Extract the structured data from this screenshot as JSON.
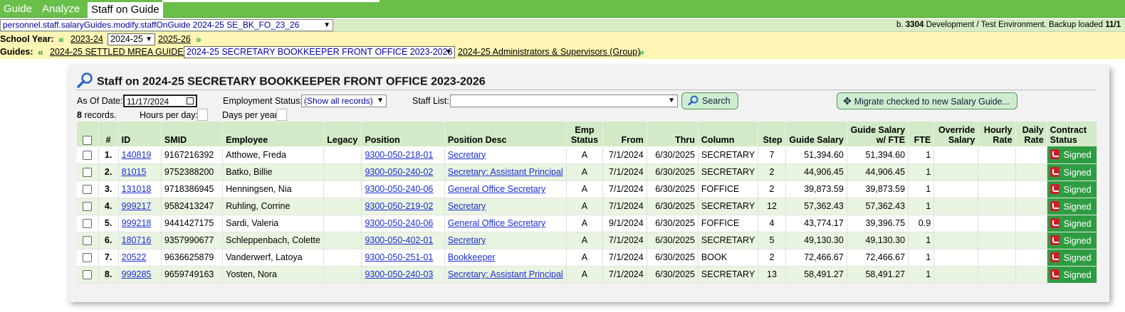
{
  "nav": {
    "tabs": [
      {
        "label": "Guide"
      },
      {
        "label": "Analyze"
      },
      {
        "label": "Staff on Guide"
      }
    ]
  },
  "pathbar": {
    "path": "personnel.staff.salaryGuides.modify.staffOnGuide 2024-25 SE_BK_FO_23_26",
    "build_prefix": "b.",
    "build_number": "3304",
    "env_text": "Development / Test Environment. Backup loaded",
    "env_date": "11/1"
  },
  "school_year": {
    "label": "School Year:",
    "prev": "2023-24",
    "current": "2024-25",
    "next": "2025-26"
  },
  "guides": {
    "label": "Guides:",
    "prev": "2024-25 SETTLED MREA GUIDES",
    "current": "2024-25 SECRETARY BOOKKEEPER FRONT OFFICE 2023-2026",
    "next": "2024-25 Administrators & Supervisors (Group)"
  },
  "panel": {
    "title": "Staff on 2024-25 SECRETARY BOOKKEEPER FRONT OFFICE 2023-2026",
    "as_of_label": "As Of Date:",
    "as_of_value": "11/17/2024",
    "emp_status_label": "Employment Status:",
    "emp_status_value": "(Show all records)",
    "staff_list_label": "Staff List:",
    "staff_list_value": "",
    "search_label": "Search",
    "migrate_label": "Migrate checked to new Salary Guide...",
    "record_count": "8",
    "records_label": "records.",
    "hours_label": "Hours per day:",
    "days_label": "Days per year:"
  },
  "table": {
    "headers": {
      "num": "#",
      "id": "ID",
      "smid": "SMID",
      "employee": "Employee",
      "legacy": "Legacy",
      "position": "Position",
      "position_desc": "Position Desc",
      "emp_status_1": "Emp",
      "emp_status_2": "Status",
      "from": "From",
      "thru": "Thru",
      "column": "Column",
      "step": "Step",
      "guide_salary": "Guide Salary",
      "guide_fte_1": "Guide Salary",
      "guide_fte_2": "w/ FTE",
      "fte": "FTE",
      "override_1": "Override",
      "override_2": "Salary",
      "hourly_1": "Hourly",
      "hourly_2": "Rate",
      "daily_1": "Daily",
      "daily_2": "Rate",
      "contract_1": "Contract",
      "contract_2": "Status"
    },
    "rows": [
      {
        "num": "1.",
        "id": "140819",
        "smid": "9167216392",
        "employee": "Atthowe, Freda",
        "legacy": "",
        "position": "9300-050-218-01",
        "desc": "Secretary",
        "status": "A",
        "from": "7/1/2024",
        "thru": "6/30/2025",
        "column": "SECRETARY",
        "step": "7",
        "salary": "51,394.60",
        "salary_fte": "51,394.60",
        "fte": "1",
        "override": "",
        "hourly": "",
        "daily": "",
        "contract": "Signed"
      },
      {
        "num": "2.",
        "id": "81015",
        "smid": "9752388200",
        "employee": "Batko, Billie",
        "legacy": "",
        "position": "9300-050-240-02",
        "desc": "Secretary: Assistant Principal",
        "status": "A",
        "from": "7/1/2024",
        "thru": "6/30/2025",
        "column": "SECRETARY",
        "step": "2",
        "salary": "44,906.45",
        "salary_fte": "44,906.45",
        "fte": "1",
        "override": "",
        "hourly": "",
        "daily": "",
        "contract": "Signed"
      },
      {
        "num": "3.",
        "id": "131018",
        "smid": "9718386945",
        "employee": "Henningsen, Nia",
        "legacy": "",
        "position": "9300-050-240-06",
        "desc": "General Office Secretary",
        "status": "A",
        "from": "7/1/2024",
        "thru": "6/30/2025",
        "column": "FOFFICE",
        "step": "2",
        "salary": "39,873.59",
        "salary_fte": "39,873.59",
        "fte": "1",
        "override": "",
        "hourly": "",
        "daily": "",
        "contract": "Signed"
      },
      {
        "num": "4.",
        "id": "999217",
        "smid": "9582413247",
        "employee": "Ruhling, Corrine",
        "legacy": "",
        "position": "9300-050-219-02",
        "desc": "Secretary",
        "status": "A",
        "from": "7/1/2024",
        "thru": "6/30/2025",
        "column": "SECRETARY",
        "step": "12",
        "salary": "57,362.43",
        "salary_fte": "57,362.43",
        "fte": "1",
        "override": "",
        "hourly": "",
        "daily": "",
        "contract": "Signed"
      },
      {
        "num": "5.",
        "id": "999218",
        "smid": "9441427175",
        "employee": "Sardi, Valeria",
        "legacy": "",
        "position": "9300-050-240-06",
        "desc": "General Office Secretary",
        "status": "A",
        "from": "9/1/2024",
        "thru": "6/30/2025",
        "column": "FOFFICE",
        "step": "4",
        "salary": "43,774.17",
        "salary_fte": "39,396.75",
        "fte": "0.9",
        "override": "",
        "hourly": "",
        "daily": "",
        "contract": "Signed"
      },
      {
        "num": "6.",
        "id": "180716",
        "smid": "9357990677",
        "employee": "Schleppenbach, Colette",
        "legacy": "",
        "position": "9300-050-402-01",
        "desc": "Secretary",
        "status": "A",
        "from": "7/1/2024",
        "thru": "6/30/2025",
        "column": "SECRETARY",
        "step": "5",
        "salary": "49,130.30",
        "salary_fte": "49,130.30",
        "fte": "1",
        "override": "",
        "hourly": "",
        "daily": "",
        "contract": "Signed"
      },
      {
        "num": "7.",
        "id": "20522",
        "smid": "9636625879",
        "employee": "Vanderwerf, Latoya",
        "legacy": "",
        "position": "9300-050-251-01",
        "desc": "Bookkeeper",
        "status": "A",
        "from": "7/1/2024",
        "thru": "6/30/2025",
        "column": "BOOK",
        "step": "2",
        "salary": "72,466.67",
        "salary_fte": "72,466.67",
        "fte": "1",
        "override": "",
        "hourly": "",
        "daily": "",
        "contract": "Signed"
      },
      {
        "num": "8.",
        "id": "999285",
        "smid": "9659749163",
        "employee": "Yosten, Nora",
        "legacy": "",
        "position": "9300-050-240-03",
        "desc": "Secretary: Assistant Principal",
        "status": "A",
        "from": "7/1/2024",
        "thru": "6/30/2025",
        "column": "SECRETARY",
        "step": "13",
        "salary": "58,491.27",
        "salary_fte": "58,491.27",
        "fte": "1",
        "override": "",
        "hourly": "",
        "daily": "",
        "contract": "Signed"
      }
    ]
  },
  "colors": {
    "nav_green": "#6abf4b",
    "path_bar": "#d9ecc6",
    "year_bar": "#fff5b4",
    "signed_green": "#2e9d42",
    "link_blue": "#1b2fd8"
  }
}
